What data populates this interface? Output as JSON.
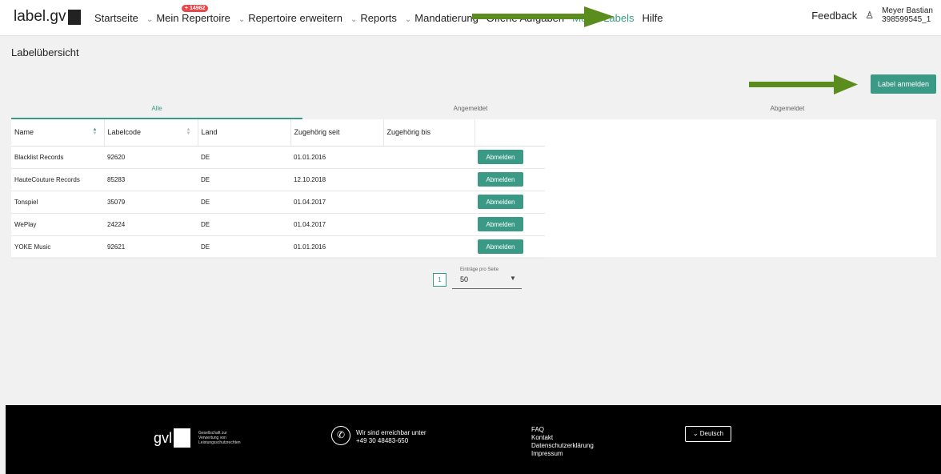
{
  "header": {
    "logo": "label.gvl",
    "nav": [
      {
        "label": "Startseite",
        "chevron": false
      },
      {
        "label": "Mein Repertoire",
        "chevron": true,
        "badge": "+ 14962"
      },
      {
        "label": "Repertoire erweitern",
        "chevron": true
      },
      {
        "label": "Reports",
        "chevron": true
      },
      {
        "label": "Mandatierung",
        "chevron": true
      },
      {
        "label": "Offene Aufgaben",
        "chevron": false
      },
      {
        "label": "Meine Labels",
        "chevron": false,
        "active": true
      },
      {
        "label": "Hilfe",
        "chevron": false
      }
    ],
    "feedback": "Feedback",
    "user_name": "Meyer Bastian",
    "user_id": "398599545_1"
  },
  "page": {
    "title": "Labelübersicht",
    "add_button": "Label anmelden",
    "tabs": [
      "Alle",
      "Angemeldet",
      "Abgemeldet"
    ],
    "active_tab": "Alle"
  },
  "table": {
    "columns": [
      "Name",
      "Labelcode",
      "Land",
      "Zugehörig seit",
      "Zugehörig bis"
    ],
    "row_button": "Abmelden",
    "rows": [
      {
        "name": "Blacklist Records",
        "code": "92620",
        "land": "DE",
        "seit": "01.01.2016",
        "bis": ""
      },
      {
        "name": "HauteCouture Records",
        "code": "85283",
        "land": "DE",
        "seit": "12.10.2018",
        "bis": ""
      },
      {
        "name": "Tonspiel",
        "code": "35079",
        "land": "DE",
        "seit": "01.04.2017",
        "bis": ""
      },
      {
        "name": "WePlay",
        "code": "24224",
        "land": "DE",
        "seit": "01.04.2017",
        "bis": ""
      },
      {
        "name": "YOKE Music",
        "code": "92621",
        "land": "DE",
        "seit": "01.01.2016",
        "bis": ""
      }
    ]
  },
  "pagination": {
    "page": "1",
    "per_page_label": "Einträge pro Seite",
    "per_page": "50"
  },
  "footer": {
    "logo": "gvl",
    "logo_sub": [
      "Gesellschaft zur",
      "Verwertung von",
      "Leistungsschutzrechten"
    ],
    "contact_title": "Wir sind erreichbar unter",
    "phone": "+49 30 48483-650",
    "links": [
      "FAQ",
      "Kontakt",
      "Datenschutzerklärung",
      "Impressum"
    ],
    "language": "Deutsch"
  },
  "colors": {
    "accent": "#3a9a86",
    "arrow": "#5b8c1e",
    "badge": "#e8484b"
  }
}
